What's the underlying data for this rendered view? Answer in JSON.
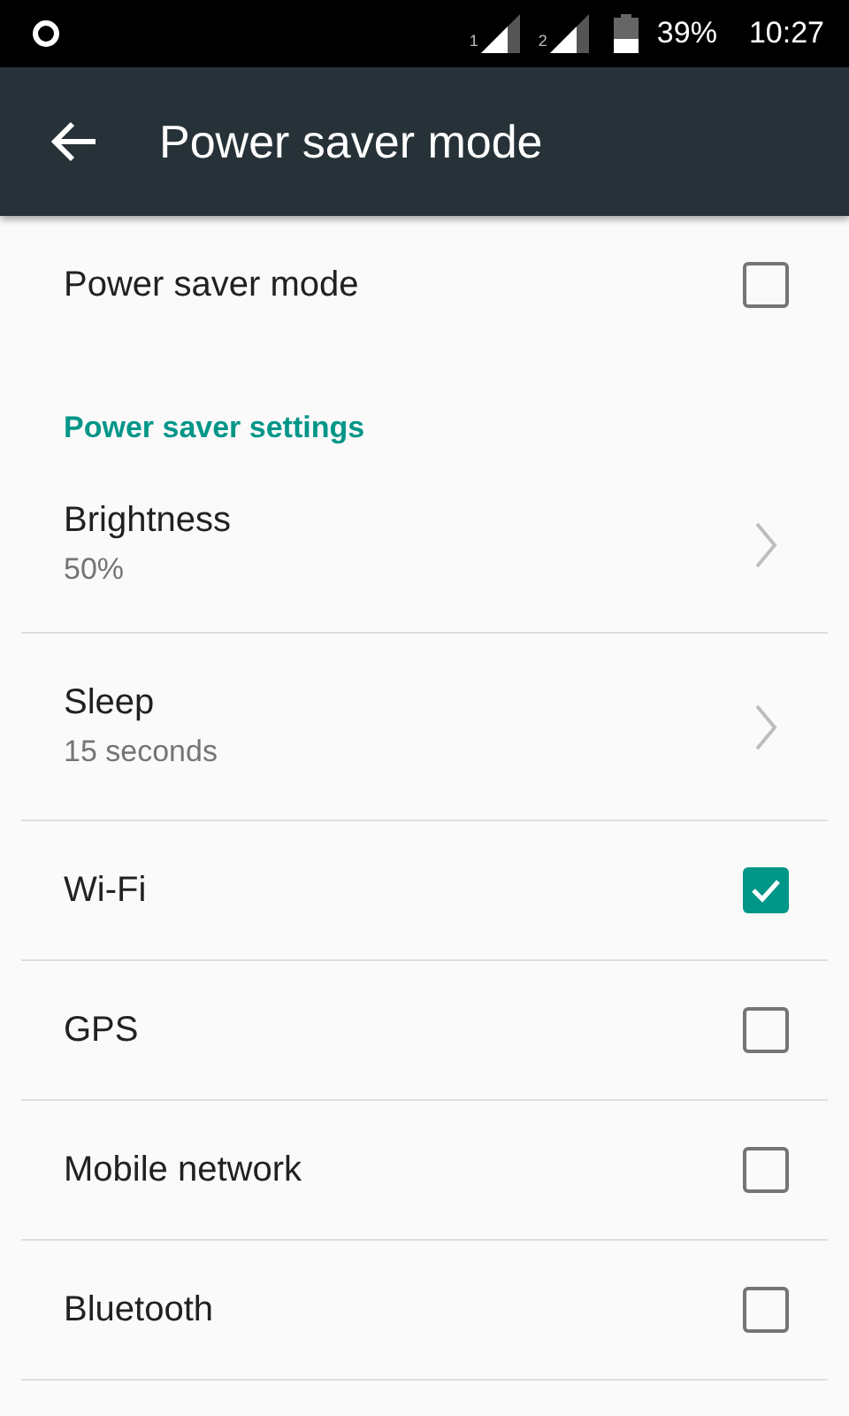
{
  "status_bar": {
    "sims": [
      {
        "label": "1"
      },
      {
        "label": "2"
      }
    ],
    "battery": "39%",
    "time": "10:27"
  },
  "toolbar": {
    "title": "Power saver mode"
  },
  "master": {
    "label": "Power saver mode",
    "checked": false
  },
  "section": {
    "title": "Power saver settings"
  },
  "items": [
    {
      "kind": "link",
      "label": "Brightness",
      "summary": "50%"
    },
    {
      "kind": "link",
      "label": "Sleep",
      "summary": "15 seconds"
    },
    {
      "kind": "checkbox",
      "label": "Wi-Fi",
      "checked": true
    },
    {
      "kind": "checkbox",
      "label": "GPS",
      "checked": false
    },
    {
      "kind": "checkbox",
      "label": "Mobile network",
      "checked": false
    },
    {
      "kind": "checkbox",
      "label": "Bluetooth",
      "checked": false
    }
  ]
}
